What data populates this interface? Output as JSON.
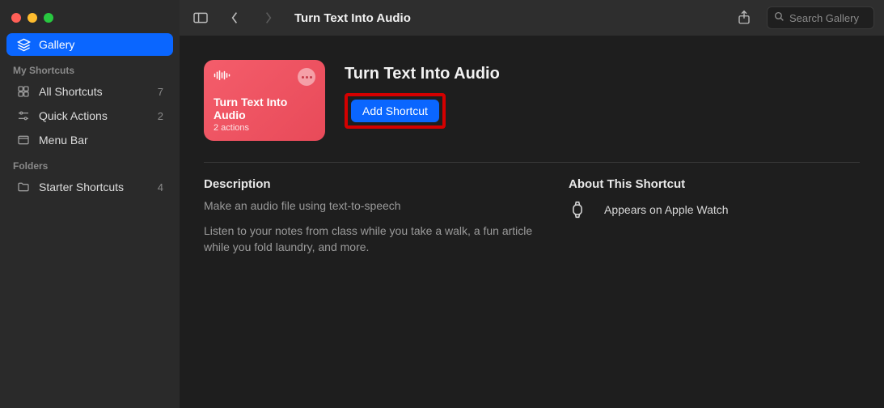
{
  "toolbar": {
    "title": "Turn Text Into Audio",
    "search_placeholder": "Search Gallery"
  },
  "sidebar": {
    "gallery_label": "Gallery",
    "my_shortcuts_header": "My Shortcuts",
    "items": [
      {
        "label": "All Shortcuts",
        "count": "7",
        "icon": "grid"
      },
      {
        "label": "Quick Actions",
        "count": "2",
        "icon": "sliders"
      },
      {
        "label": "Menu Bar",
        "count": "",
        "icon": "menubar"
      }
    ],
    "folders_header": "Folders",
    "folders": [
      {
        "label": "Starter Shortcuts",
        "count": "4"
      }
    ]
  },
  "hero": {
    "card_title": "Turn Text Into Audio",
    "card_sub": "2 actions",
    "heading": "Turn Text Into Audio",
    "add_label": "Add Shortcut"
  },
  "desc": {
    "title": "Description",
    "p1": "Make an audio file using text-to-speech",
    "p2": "Listen to your notes from class while you take a walk, a fun article while you fold laundry, and more."
  },
  "about": {
    "title": "About This Shortcut",
    "watch": "Appears on Apple Watch"
  }
}
